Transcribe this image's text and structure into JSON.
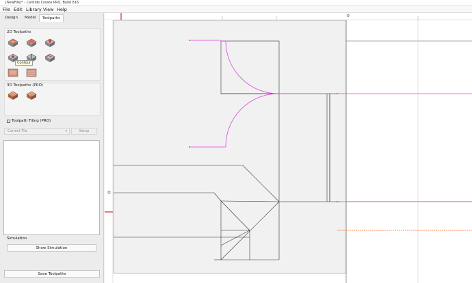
{
  "window": {
    "title": "[NewFile]* - Carbide Create PRO, Build 816"
  },
  "menu": [
    "File",
    "Edit",
    "Library",
    "View",
    "Help"
  ],
  "tabs": [
    "Design",
    "Model",
    "Toolpaths"
  ],
  "toolpaths_2d": {
    "title": "2D Toolpaths",
    "tooltip": "Contour",
    "items": [
      "contour-toolpath-icon",
      "pocket-toolpath-icon",
      "vcarve-toolpath-icon",
      "drill-toolpath-icon",
      "advanced-vcarve-toolpath-icon",
      "texture-toolpath-icon",
      "engrave-toolpath-icon",
      "fillet-toolpath-icon"
    ]
  },
  "toolpaths_3d": {
    "title": "3D Toolpaths (PRO)",
    "items": [
      "3d-rough-toolpath-icon",
      "3d-finish-toolpath-icon"
    ]
  },
  "tiling": {
    "label": "Toolpath Tiling (PRO)",
    "select_value": "Current Tile",
    "setup_label": "Setup"
  },
  "simulation": {
    "label": "Simulation",
    "show_button": "Show Simulation"
  },
  "footer": {
    "save_button": "Save Toolpaths"
  },
  "canvas": {
    "origin_label": "0"
  },
  "colors": {
    "toolpath": "#e040e0",
    "origin_marker": "#e02020",
    "stock": "#f1f1f1",
    "geometry": "#333333"
  }
}
